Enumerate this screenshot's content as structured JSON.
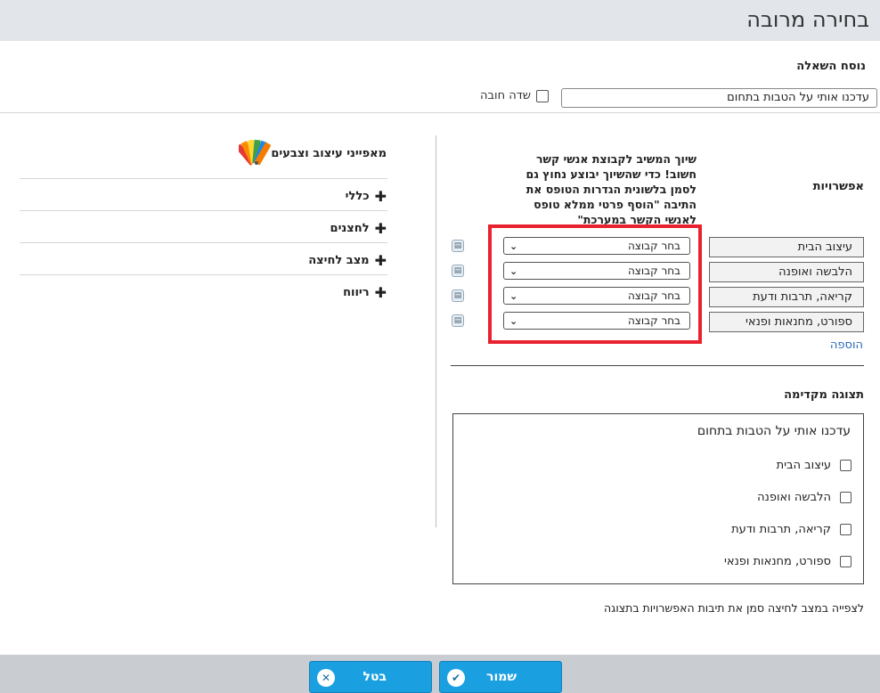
{
  "window": {
    "title": "בחירה מרובה"
  },
  "question": {
    "label": "נוסח השאלה",
    "value": "עדכנו אותי על הטבות בתחום",
    "required_label": "שדה חובה"
  },
  "left_panel": {
    "title": "מאפייני עיצוב וצבעים",
    "sections": [
      {
        "label": "כללי"
      },
      {
        "label": "לחצנים"
      },
      {
        "label": "מצב לחיצה"
      },
      {
        "label": "ריווח"
      }
    ]
  },
  "options": {
    "label": "אפשרויות",
    "note": "שיוך המשיב לקבוצת אנשי קשר חשוב! כדי שהשיוך יבוצע נחוץ גם לסמן בלשונית הגדרות הטופס את התיבה \"הוסף פרטי ממלא טופס לאנשי הקשר במערכת\"",
    "items": [
      {
        "label": "עיצוב הבית",
        "group": "בחר קבוצה"
      },
      {
        "label": "הלבשה ואופנה",
        "group": "בחר קבוצה"
      },
      {
        "label": "קריאה, תרבות ודעת",
        "group": "בחר קבוצה"
      },
      {
        "label": "ספורט, מחנאות ופנאי",
        "group": "בחר קבוצה"
      }
    ],
    "add_link": "הוספה"
  },
  "preview": {
    "label": "תצוגה מקדימה",
    "question": "עדכנו אותי על הטבות בתחום",
    "items": [
      "עיצוב הבית",
      "הלבשה ואופנה",
      "קריאה, תרבות ודעת",
      "ספורט, מחנאות ופנאי"
    ],
    "hint": "לצפייה במצב לחיצה סמן את תיבות האפשרויות בתצוגה"
  },
  "footer": {
    "save_label": "שמור",
    "cancel_label": "בטל"
  },
  "colors": {
    "accent": "#1a9fe0",
    "highlight": "#e8232f",
    "link": "#2a6ab4"
  }
}
